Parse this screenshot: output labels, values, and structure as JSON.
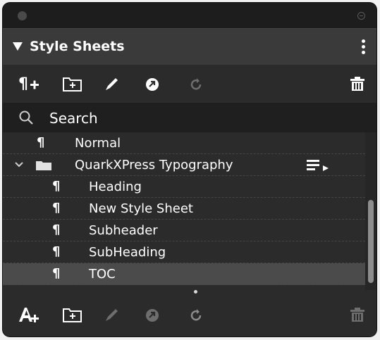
{
  "panel": {
    "title": "Style Sheets"
  },
  "search": {
    "placeholder": "Search"
  },
  "list": {
    "items": [
      {
        "label": "Normal",
        "glyph": "¶"
      },
      {
        "label": "QuarkXPress Typography",
        "glyph": "folder"
      },
      {
        "label": "Heading",
        "glyph": "¶"
      },
      {
        "label": "New Style Sheet",
        "glyph": "¶"
      },
      {
        "label": "Subheader",
        "glyph": "¶"
      },
      {
        "label": "SubHeading",
        "glyph": "¶"
      },
      {
        "label": "TOC",
        "glyph": "¶",
        "selected": true
      }
    ]
  },
  "colors": {
    "panel_bg": "#2b2b2b",
    "header_bg": "#3a3a3a",
    "selected_row": "#4b4b4b",
    "text": "#ffffff",
    "disabled_icon": "#6e6e6e"
  },
  "icons": {
    "top_toolbar": [
      "new-paragraph-style-icon",
      "new-group-icon",
      "edit-pencil-icon",
      "duplicate-icon",
      "refresh-icon",
      "trash-icon"
    ],
    "bottom_toolbar": [
      "new-character-style-icon",
      "new-group-icon",
      "edit-pencil-icon",
      "duplicate-icon",
      "refresh-icon",
      "trash-icon"
    ]
  }
}
